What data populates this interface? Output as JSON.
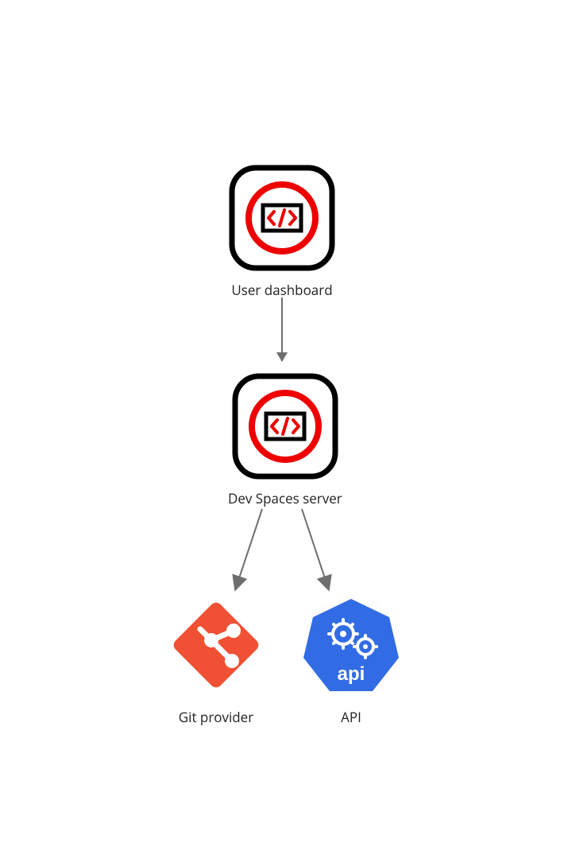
{
  "nodes": {
    "user_dashboard": {
      "label": "User dashboard"
    },
    "dev_spaces_server": {
      "label": "Dev Spaces server"
    },
    "git_provider": {
      "label": "Git provider"
    },
    "api": {
      "label": "API",
      "badge_text": "api"
    }
  },
  "colors": {
    "red": "#ee0000",
    "black": "#000000",
    "git_orange": "#f05033",
    "k8s_blue": "#326ce5",
    "arrow": "#6e6e6e"
  },
  "edges": [
    {
      "from": "user_dashboard",
      "to": "dev_spaces_server"
    },
    {
      "from": "dev_spaces_server",
      "to": "git_provider"
    },
    {
      "from": "dev_spaces_server",
      "to": "api"
    }
  ]
}
